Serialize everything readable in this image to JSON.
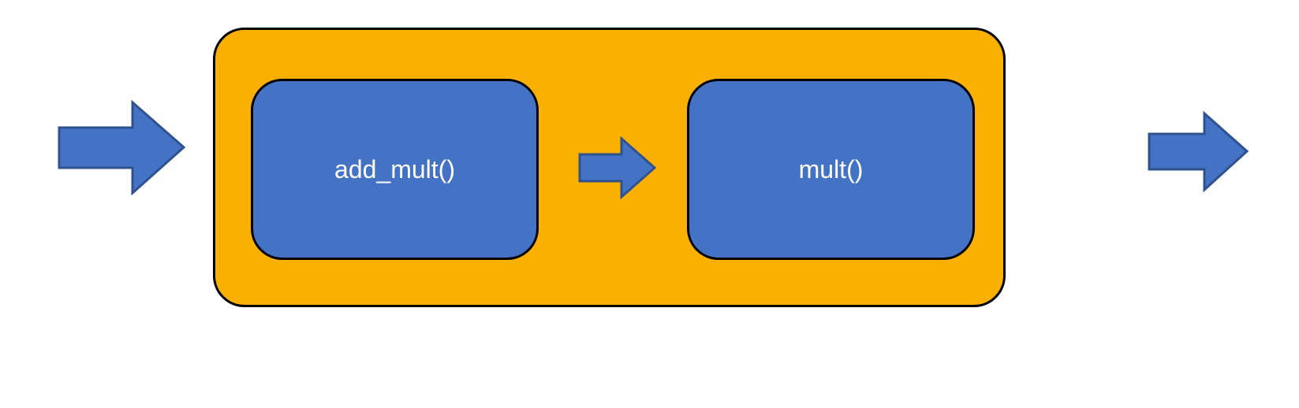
{
  "diagram": {
    "container_color": "#F9B000",
    "node_color": "#4472C4",
    "arrow_fill": "#4472C4",
    "arrow_stroke": "#2F528F",
    "nodes": {
      "left_label": "add_mult()",
      "right_label": "mult()"
    }
  }
}
